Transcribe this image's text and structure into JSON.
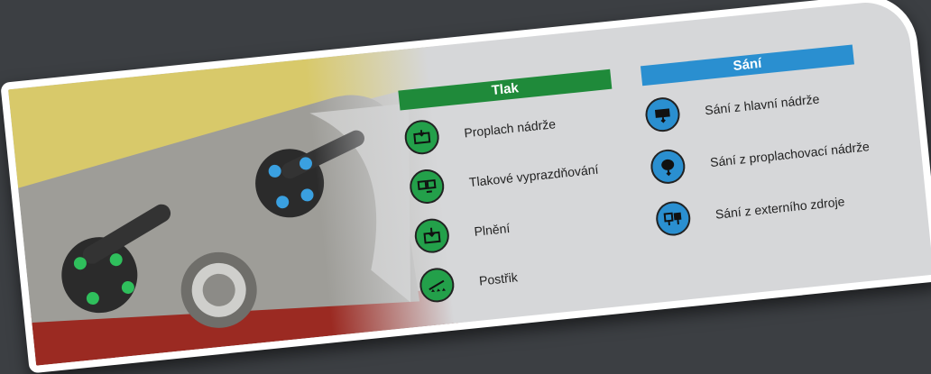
{
  "sections": {
    "tlak": {
      "title": "Tlak",
      "color": "#1f8a3a",
      "items": [
        {
          "label": "Proplach nádrže",
          "icon": "tank-rinse-icon"
        },
        {
          "label": "Tlakové vyprazdňování",
          "icon": "pressure-drain-icon"
        },
        {
          "label": "Plnění",
          "icon": "fill-icon"
        },
        {
          "label": "Postřik",
          "icon": "spray-icon"
        }
      ]
    },
    "sani": {
      "title": "Sání",
      "color": "#2a8fd0",
      "items": [
        {
          "label": "Sání z hlavní nádrže",
          "icon": "main-tank-suction-icon"
        },
        {
          "label": "Sání z proplachovací nádrže",
          "icon": "rinse-tank-suction-icon"
        },
        {
          "label": "Sání z externího zdroje",
          "icon": "external-source-suction-icon"
        }
      ]
    }
  }
}
